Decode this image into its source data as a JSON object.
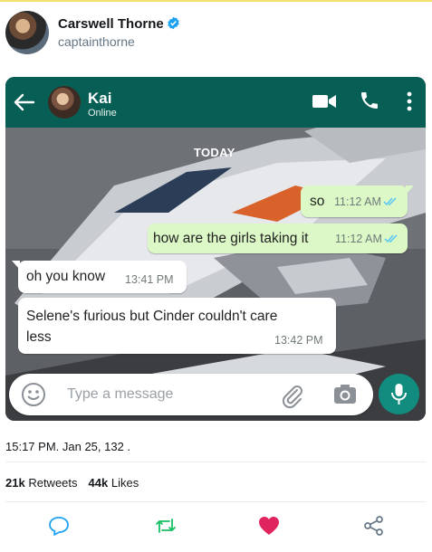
{
  "tweet": {
    "display_name": "Carswell Thorne",
    "handle": "captainthorne",
    "timestamp": "15:17 PM. Jan 25, 132 .",
    "retweets_count": "21k",
    "retweets_label": "Retweets",
    "likes_count": "44k",
    "likes_label": "Likes"
  },
  "chat": {
    "contact_name": "Kai",
    "contact_status": "Online",
    "date_label": "TODAY",
    "messages": [
      {
        "direction": "outgoing",
        "text": "so",
        "time": "11:12 AM",
        "status": "read"
      },
      {
        "direction": "outgoing",
        "text": "how are the girls taking it",
        "time": "11:12 AM",
        "status": "read"
      },
      {
        "direction": "incoming",
        "text": "oh you know",
        "time": "13:41 PM"
      },
      {
        "direction": "incoming",
        "text": "Selene's furious but Cinder couldn't care less",
        "time": "13:42 PM"
      }
    ],
    "composer_placeholder": "Type a message"
  },
  "colors": {
    "header_green": "#075e54",
    "outgoing_bubble": "#dcf8c6",
    "read_tick_blue": "#4fc3f7",
    "mic_button": "#128c7e",
    "verified_blue": "#1da1f2",
    "like_red": "#e0245e",
    "retweet_green": "#17bf63"
  },
  "icons": [
    "verified-icon",
    "back-arrow-icon",
    "video-call-icon",
    "phone-icon",
    "menu-icon",
    "emoji-icon",
    "attach-icon",
    "camera-icon",
    "mic-icon",
    "reply-icon",
    "retweet-icon",
    "like-icon",
    "share-icon"
  ]
}
